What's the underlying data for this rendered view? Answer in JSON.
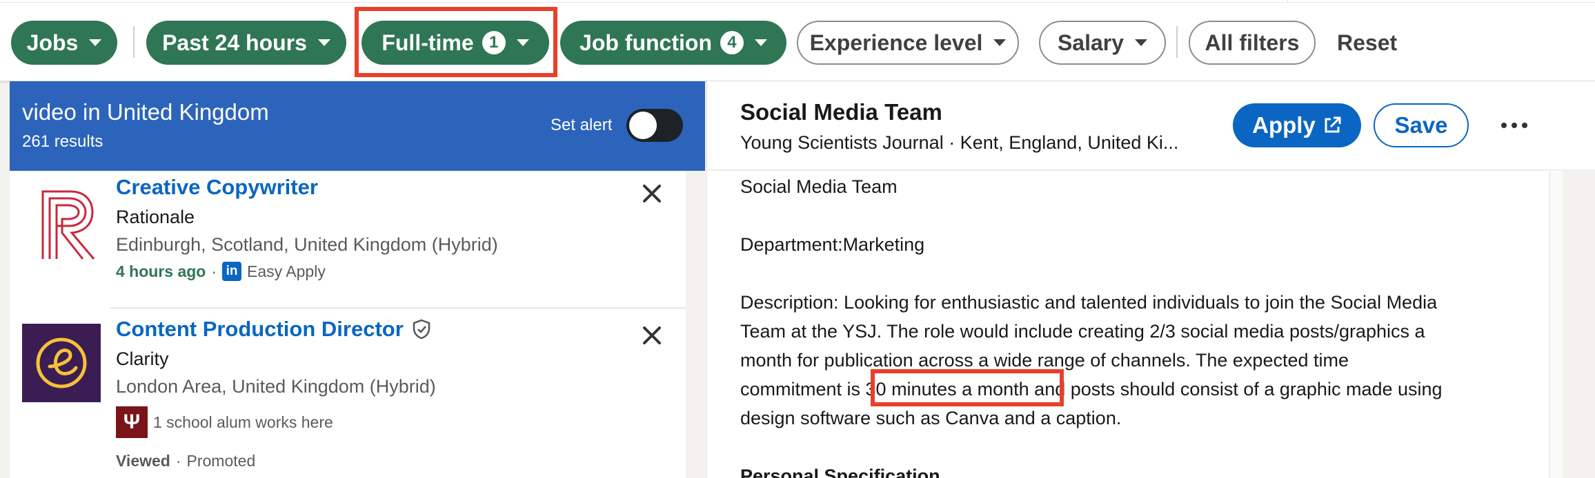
{
  "filters": {
    "jobs": {
      "label": "Jobs"
    },
    "date_posted": {
      "label": "Past 24 hours"
    },
    "job_type": {
      "label": "Full-time",
      "count": "1"
    },
    "job_function": {
      "label": "Job function",
      "count": "4"
    },
    "experience": {
      "label": "Experience level"
    },
    "salary": {
      "label": "Salary"
    },
    "all_filters": {
      "label": "All filters"
    },
    "reset": {
      "label": "Reset"
    }
  },
  "search": {
    "title": "video in United Kingdom",
    "count": "261 results",
    "alert_label": "Set alert",
    "alert_on": false
  },
  "results": [
    {
      "title": "Creative Copywriter",
      "company": "Rationale",
      "location": "Edinburgh, Scotland, United Kingdom (Hybrid)",
      "time_ago": "4 hours ago",
      "apply_type": "Easy Apply"
    },
    {
      "title": "Content Production Director",
      "company": "Clarity",
      "location": "London Area, United Kingdom (Hybrid)",
      "insight": "1 school alum works here",
      "status": "Viewed",
      "promoted": "Promoted"
    }
  ],
  "detail": {
    "title": "Social Media Team",
    "subtitle": "Young Scientists Journal · Kent, England, United Ki...",
    "apply_label": "Apply",
    "save_label": "Save",
    "line1": "Social Media Team",
    "line2": "Department:Marketing",
    "desc_a": "Description: Looking for enthusiastic and talented individuals to join the Social Media",
    "desc_b": "Team at the YSJ. The role would include creating 2/3 social media posts/graphics a",
    "desc_c": "month for publication across a wide range of channels. The expected time",
    "desc_d_pre": "commitment is ",
    "desc_d_highlight": "30 minutes a month",
    "desc_d_post": " and posts should consist of a graphic made using",
    "desc_e": "design software such as Canva and a caption.",
    "heading": "Personal Specification"
  },
  "colors": {
    "active_pill": "#2f7654",
    "link_blue": "#0a66c2",
    "header_blue": "#2c64bc",
    "annotation_red": "#e8402a",
    "time_green": "#2f7654"
  }
}
